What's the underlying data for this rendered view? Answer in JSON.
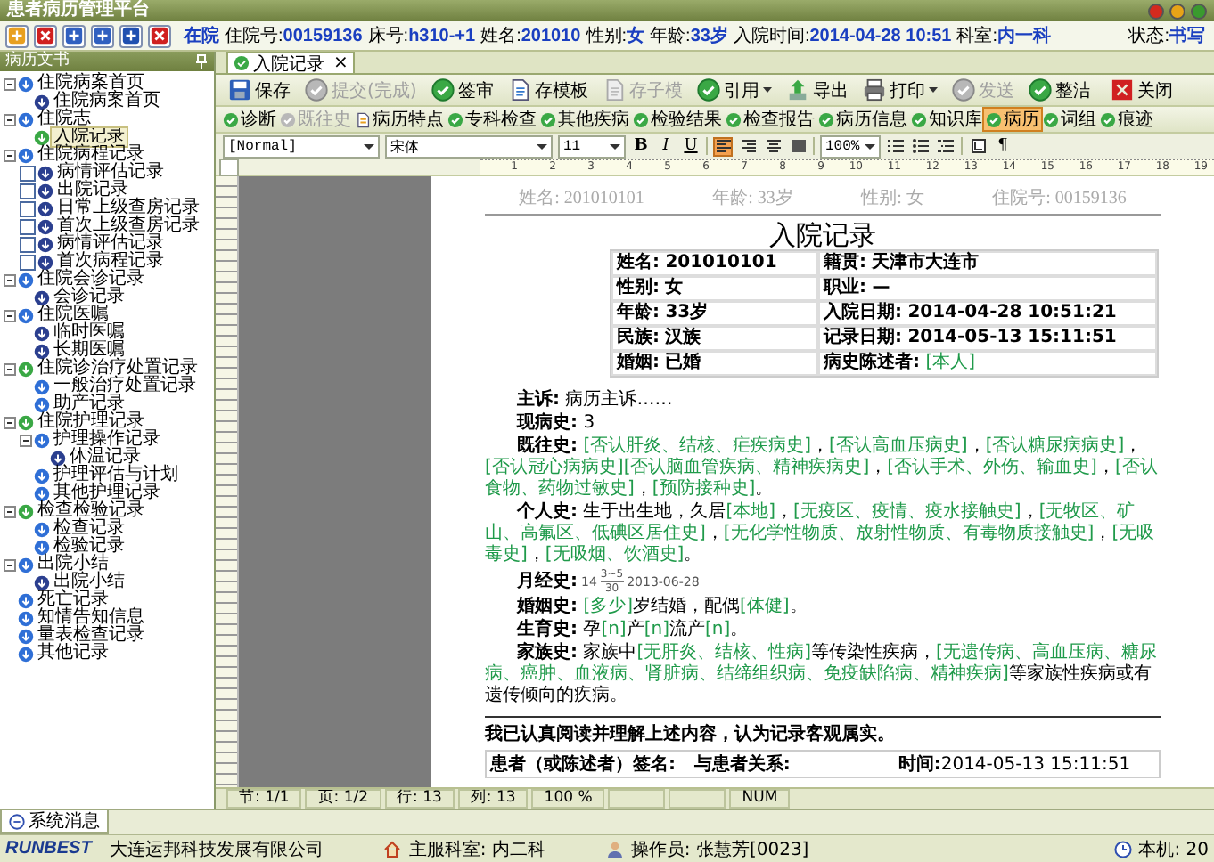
{
  "window": {
    "title": "患者病历管理平台"
  },
  "patient_bar": {
    "status_flag": "在院",
    "fields": [
      {
        "label": "住院号:",
        "value": "00159136"
      },
      {
        "label": "床号:",
        "value": "h310-+1"
      },
      {
        "label": "姓名:",
        "value": "201010"
      },
      {
        "label": "性别:",
        "value": "女"
      },
      {
        "label": "年龄:",
        "value": "33岁"
      },
      {
        "label": "入院时间:",
        "value": "2014-04-28 10:51"
      },
      {
        "label": "科室:",
        "value": "内一科"
      }
    ],
    "state": {
      "label": "状态:",
      "value": "书写"
    }
  },
  "sidebar": {
    "title": "病历文书",
    "items": [
      {
        "label": "住院病案首页",
        "color": "#2f6fd6",
        "expanded": true,
        "selected": false,
        "children": [
          {
            "label": "住院病案首页",
            "color": "#2b3f8f",
            "selected": false
          }
        ]
      },
      {
        "label": "住院志",
        "color": "#2f6fd6",
        "expanded": true,
        "selected": false,
        "children": [
          {
            "label": "入院记录",
            "color": "#3aa845",
            "selected": true
          }
        ]
      },
      {
        "label": "住院病程记录",
        "color": "#2f6fd6",
        "expanded": true,
        "selected": false,
        "children": [
          {
            "label": "病情评估记录",
            "color": "#2b3f8f",
            "checked": false,
            "selected": false
          },
          {
            "label": "出院记录",
            "color": "#2b3f8f",
            "checked": false,
            "selected": false
          },
          {
            "label": "日常上级查房记录",
            "color": "#2b3f8f",
            "checked": false,
            "selected": false
          },
          {
            "label": "首次上级查房记录",
            "color": "#2b3f8f",
            "checked": false,
            "selected": false
          },
          {
            "label": "病情评估记录",
            "color": "#2b3f8f",
            "checked": false,
            "selected": false
          },
          {
            "label": "首次病程记录",
            "color": "#2b3f8f",
            "checked": false,
            "selected": false
          }
        ]
      },
      {
        "label": "住院会诊记录",
        "color": "#2f6fd6",
        "expanded": true,
        "selected": false,
        "children": [
          {
            "label": "会诊记录",
            "color": "#2b3f8f",
            "selected": false
          }
        ]
      },
      {
        "label": "住院医嘱",
        "color": "#2f6fd6",
        "expanded": true,
        "selected": false,
        "children": [
          {
            "label": "临时医嘱",
            "color": "#2b3f8f",
            "selected": false
          },
          {
            "label": "长期医嘱",
            "color": "#2b3f8f",
            "selected": false
          }
        ]
      },
      {
        "label": "住院诊治疗处置记录",
        "color": "#3aa845",
        "expanded": true,
        "selected": false,
        "children": [
          {
            "label": "一般治疗处置记录",
            "color": "#2f6fd6",
            "selected": false
          },
          {
            "label": "助产记录",
            "color": "#2f6fd6",
            "selected": false
          }
        ]
      },
      {
        "label": "住院护理记录",
        "color": "#3aa845",
        "expanded": true,
        "selected": false,
        "children": [
          {
            "label": "护理操作记录",
            "color": "#2f6fd6",
            "expanded": true,
            "selected": false,
            "children": [
              {
                "label": "体温记录",
                "color": "#2b3f8f",
                "selected": false
              }
            ]
          },
          {
            "label": "护理评估与计划",
            "color": "#2f6fd6",
            "selected": false
          },
          {
            "label": "其他护理记录",
            "color": "#2f6fd6",
            "selected": false
          }
        ]
      },
      {
        "label": "检查检验记录",
        "color": "#3aa845",
        "expanded": true,
        "selected": false,
        "children": [
          {
            "label": "检查记录",
            "color": "#2f6fd6",
            "selected": false
          },
          {
            "label": "检验记录",
            "color": "#2f6fd6",
            "selected": false
          }
        ]
      },
      {
        "label": "出院小结",
        "color": "#2f6fd6",
        "expanded": true,
        "selected": false,
        "children": [
          {
            "label": "出院小结",
            "color": "#2b3f8f",
            "selected": false
          }
        ]
      },
      {
        "label": "死亡记录",
        "color": "#2f6fd6",
        "selected": false
      },
      {
        "label": "知情告知信息",
        "color": "#2f6fd6",
        "selected": false
      },
      {
        "label": "量表检查记录",
        "color": "#2f6fd6",
        "selected": false
      },
      {
        "label": "其他记录",
        "color": "#2f6fd6",
        "selected": false
      }
    ]
  },
  "tabs": [
    {
      "label": "入院记录",
      "selected": true,
      "close": "×"
    }
  ],
  "toolbar": [
    {
      "label": "保存",
      "disabled": false,
      "dropdown": false
    },
    {
      "label": "提交(完成)",
      "disabled": true,
      "dropdown": false
    },
    {
      "label": "签审",
      "disabled": false,
      "dropdown": false
    },
    {
      "label": "存模板",
      "disabled": false,
      "dropdown": false
    },
    {
      "label": "存子模",
      "disabled": true,
      "dropdown": false
    },
    {
      "label": "引用",
      "disabled": false,
      "dropdown": true
    },
    {
      "label": "导出",
      "disabled": false,
      "dropdown": false
    },
    {
      "label": "打印",
      "disabled": false,
      "dropdown": true
    },
    {
      "label": "发送",
      "disabled": true,
      "dropdown": false
    },
    {
      "label": "整洁",
      "disabled": false,
      "dropdown": false
    },
    {
      "label": "关闭",
      "disabled": false,
      "dropdown": false
    }
  ],
  "toolbar_2": [
    {
      "label": "诊断",
      "disabled": false,
      "selected": false
    },
    {
      "label": "既往史",
      "disabled": true,
      "selected": false
    },
    {
      "label": "病历特点",
      "disabled": false,
      "selected": false
    },
    {
      "label": "专科检查",
      "disabled": false,
      "selected": false
    },
    {
      "label": "其他疾病",
      "disabled": false,
      "selected": false
    },
    {
      "label": "检验结果",
      "disabled": false,
      "selected": false
    },
    {
      "label": "检查报告",
      "disabled": false,
      "selected": false
    },
    {
      "label": "病历信息",
      "disabled": false,
      "selected": false
    },
    {
      "label": "知识库",
      "disabled": false,
      "selected": false
    },
    {
      "label": "病历",
      "disabled": false,
      "selected": true
    },
    {
      "label": "词组",
      "disabled": false,
      "selected": false
    },
    {
      "label": "痕迹",
      "disabled": false,
      "selected": false
    }
  ],
  "format_bar": {
    "style": "[Normal]",
    "font": "宋体",
    "size": "11",
    "bold": "B",
    "italic": "I",
    "underline": "U",
    "alignments": [
      {
        "selected": true
      },
      {
        "selected": false
      },
      {
        "selected": false
      },
      {
        "selected": false
      }
    ],
    "zoom": "100%",
    "pilcrow": "¶"
  },
  "ruler": {
    "labels": [
      "1",
      "2",
      "3",
      "4",
      "5",
      "6",
      "7",
      "8",
      "9",
      "10",
      "11",
      "12",
      "13",
      "14",
      "15",
      "16",
      "17",
      "18",
      "19"
    ]
  },
  "document": {
    "header": [
      {
        "label": "姓名:",
        "value": "201010101"
      },
      {
        "label": "年龄:",
        "value": "33岁"
      },
      {
        "label": "性别:",
        "value": "女"
      },
      {
        "label": "住院号:",
        "value": "00159136"
      }
    ],
    "title": "入院记录",
    "info_table": [
      [
        {
          "label": "姓名:",
          "value": "201010101",
          "kind": "plain"
        },
        {
          "label": "籍贯:",
          "value": "天津市大连市",
          "kind": "plain"
        }
      ],
      [
        {
          "label": "性别:",
          "value": "女",
          "kind": "plain"
        },
        {
          "label": "职业:",
          "value": "—",
          "kind": "plain"
        }
      ],
      [
        {
          "label": "年龄:",
          "value": "33岁",
          "kind": "plain"
        },
        {
          "label": "入院日期:",
          "value": "2014-04-28 10:51:21",
          "kind": "plain"
        }
      ],
      [
        {
          "label": "民族:",
          "value": "汉族",
          "kind": "plain"
        },
        {
          "label": "记录日期:",
          "value": "2014-05-13 15:11:51",
          "kind": "plain"
        }
      ],
      [
        {
          "label": "婚姻:",
          "value": "已婚",
          "kind": "plain"
        },
        {
          "label": "病史陈述者:",
          "value": "[本人]",
          "kind": "field"
        }
      ]
    ],
    "sections": [
      {
        "label": "主诉:",
        "kind": "text",
        "segments": [
          {
            "text": "病历主诉……",
            "kind": "plain"
          }
        ]
      },
      {
        "label": "现病史:",
        "kind": "text",
        "segments": [
          {
            "text": "3",
            "kind": "plain"
          }
        ]
      },
      {
        "label": "既往史:",
        "kind": "text",
        "segments": [
          {
            "text": "[否认肝炎、结核、疟疾病史]",
            "kind": "field"
          },
          {
            "text": "，",
            "kind": "plain"
          },
          {
            "text": "[否认高血压病史]",
            "kind": "field"
          },
          {
            "text": "，",
            "kind": "plain"
          },
          {
            "text": "[否认糖尿病病史]",
            "kind": "field"
          },
          {
            "text": "，",
            "kind": "plain"
          },
          {
            "text": "[否认冠心病病史]",
            "kind": "field"
          },
          {
            "text": "[否认脑血管疾病、精神疾病史]",
            "kind": "field"
          },
          {
            "text": "，",
            "kind": "plain"
          },
          {
            "text": "[否认手术、外伤、输血史]",
            "kind": "field"
          },
          {
            "text": "，",
            "kind": "plain"
          },
          {
            "text": "[否认食物、药物过敏史]",
            "kind": "field"
          },
          {
            "text": "，",
            "kind": "plain"
          },
          {
            "text": "[预防接种史]",
            "kind": "field"
          },
          {
            "text": "。",
            "kind": "plain"
          }
        ]
      },
      {
        "label": "个人史:",
        "kind": "text",
        "segments": [
          {
            "text": "生于出生地，久居",
            "kind": "plain"
          },
          {
            "text": "[本地]",
            "kind": "field"
          },
          {
            "text": "，",
            "kind": "plain"
          },
          {
            "text": "[无疫区、疫情、疫水接触史]",
            "kind": "field"
          },
          {
            "text": "，",
            "kind": "plain"
          },
          {
            "text": "[无牧区、矿山、高氟区、低碘区居住史]",
            "kind": "field"
          },
          {
            "text": "，",
            "kind": "plain"
          },
          {
            "text": "[无化学性物质、放射性物质、有毒物质接触史]",
            "kind": "field"
          },
          {
            "text": "，",
            "kind": "plain"
          },
          {
            "text": "[无吸毒史]",
            "kind": "field"
          },
          {
            "text": "，",
            "kind": "plain"
          },
          {
            "text": "[无吸烟、饮酒史]",
            "kind": "field"
          },
          {
            "text": "。",
            "kind": "plain"
          }
        ]
      },
      {
        "label": "月经史:",
        "kind": "menstrual",
        "age": "14",
        "numerator": "3~5",
        "denominator": "30",
        "date": "2013-06-28"
      },
      {
        "label": "婚姻史:",
        "kind": "text",
        "segments": [
          {
            "text": "[多少]",
            "kind": "field"
          },
          {
            "text": "岁结婚，配偶",
            "kind": "plain"
          },
          {
            "text": "[体健]",
            "kind": "field"
          },
          {
            "text": "。",
            "kind": "plain"
          }
        ]
      },
      {
        "label": "生育史:",
        "kind": "text",
        "segments": [
          {
            "text": "孕",
            "kind": "plain"
          },
          {
            "text": "[n]",
            "kind": "field"
          },
          {
            "text": "产",
            "kind": "plain"
          },
          {
            "text": "[n]",
            "kind": "field"
          },
          {
            "text": "流产",
            "kind": "plain"
          },
          {
            "text": "[n]",
            "kind": "field"
          },
          {
            "text": "。",
            "kind": "plain"
          }
        ]
      },
      {
        "label": "家族史:",
        "kind": "text",
        "segments": [
          {
            "text": "家族中",
            "kind": "plain"
          },
          {
            "text": "[无肝炎、结核、性病]",
            "kind": "field"
          },
          {
            "text": "等传染性疾病，",
            "kind": "plain"
          },
          {
            "text": "[无遗传病、高血压病、糖尿病、癌肿、血液病、肾脏病、结缔组织病、免疫缺陷病、精神疾病]",
            "kind": "field"
          },
          {
            "text": "等家族性疾病或有遗传倾向的疾病。",
            "kind": "plain"
          }
        ]
      }
    ],
    "consent": "我已认真阅读并理解上述内容，认为记录客观属实。",
    "signature": [
      {
        "label": "患者（或陈述者）签名:"
      },
      {
        "label": "与患者关系:"
      },
      {
        "label": "时间:",
        "value": "2014-05-13 15:11:51"
      }
    ]
  },
  "status_bar": [
    "节: 1/1",
    "页: 1/2",
    "行: 13",
    "列: 13",
    "100 %",
    "NUM"
  ],
  "message_tab": {
    "label": "系统消息"
  },
  "footer": {
    "logo": "RUNBEST",
    "company": "大连运邦科技发展有限公司",
    "department": "主服科室: 内二科",
    "operator": "操作员: 张慧芳[0023]",
    "machine": "本机: 20"
  }
}
